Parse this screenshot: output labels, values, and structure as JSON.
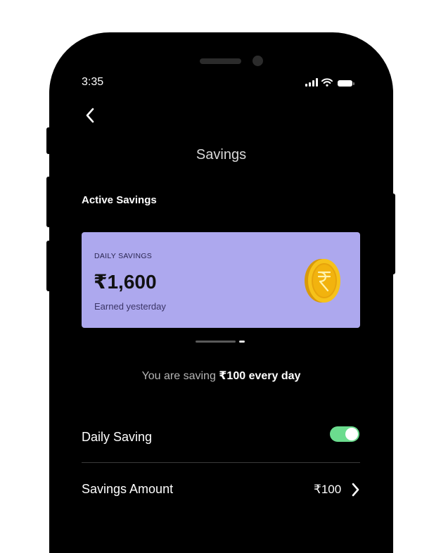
{
  "status_bar": {
    "time": "3:35"
  },
  "header": {
    "title": "Savings"
  },
  "active_savings": {
    "label": "Active Savings",
    "card": {
      "label": "DAILY SAVINGS",
      "amount": "₹1,600",
      "subtitle": "Earned yesterday"
    },
    "pager": {
      "count": 2,
      "active": 1
    }
  },
  "summary": {
    "prefix": "You are saving ",
    "highlight": "₹100 every day"
  },
  "settings": {
    "daily_saving": {
      "label": "Daily Saving",
      "enabled": true
    },
    "savings_amount": {
      "label": "Savings Amount",
      "value": "₹100"
    }
  },
  "colors": {
    "card": "#ada8ee",
    "toggle_on": "#6bdc8e",
    "background": "#000000"
  }
}
